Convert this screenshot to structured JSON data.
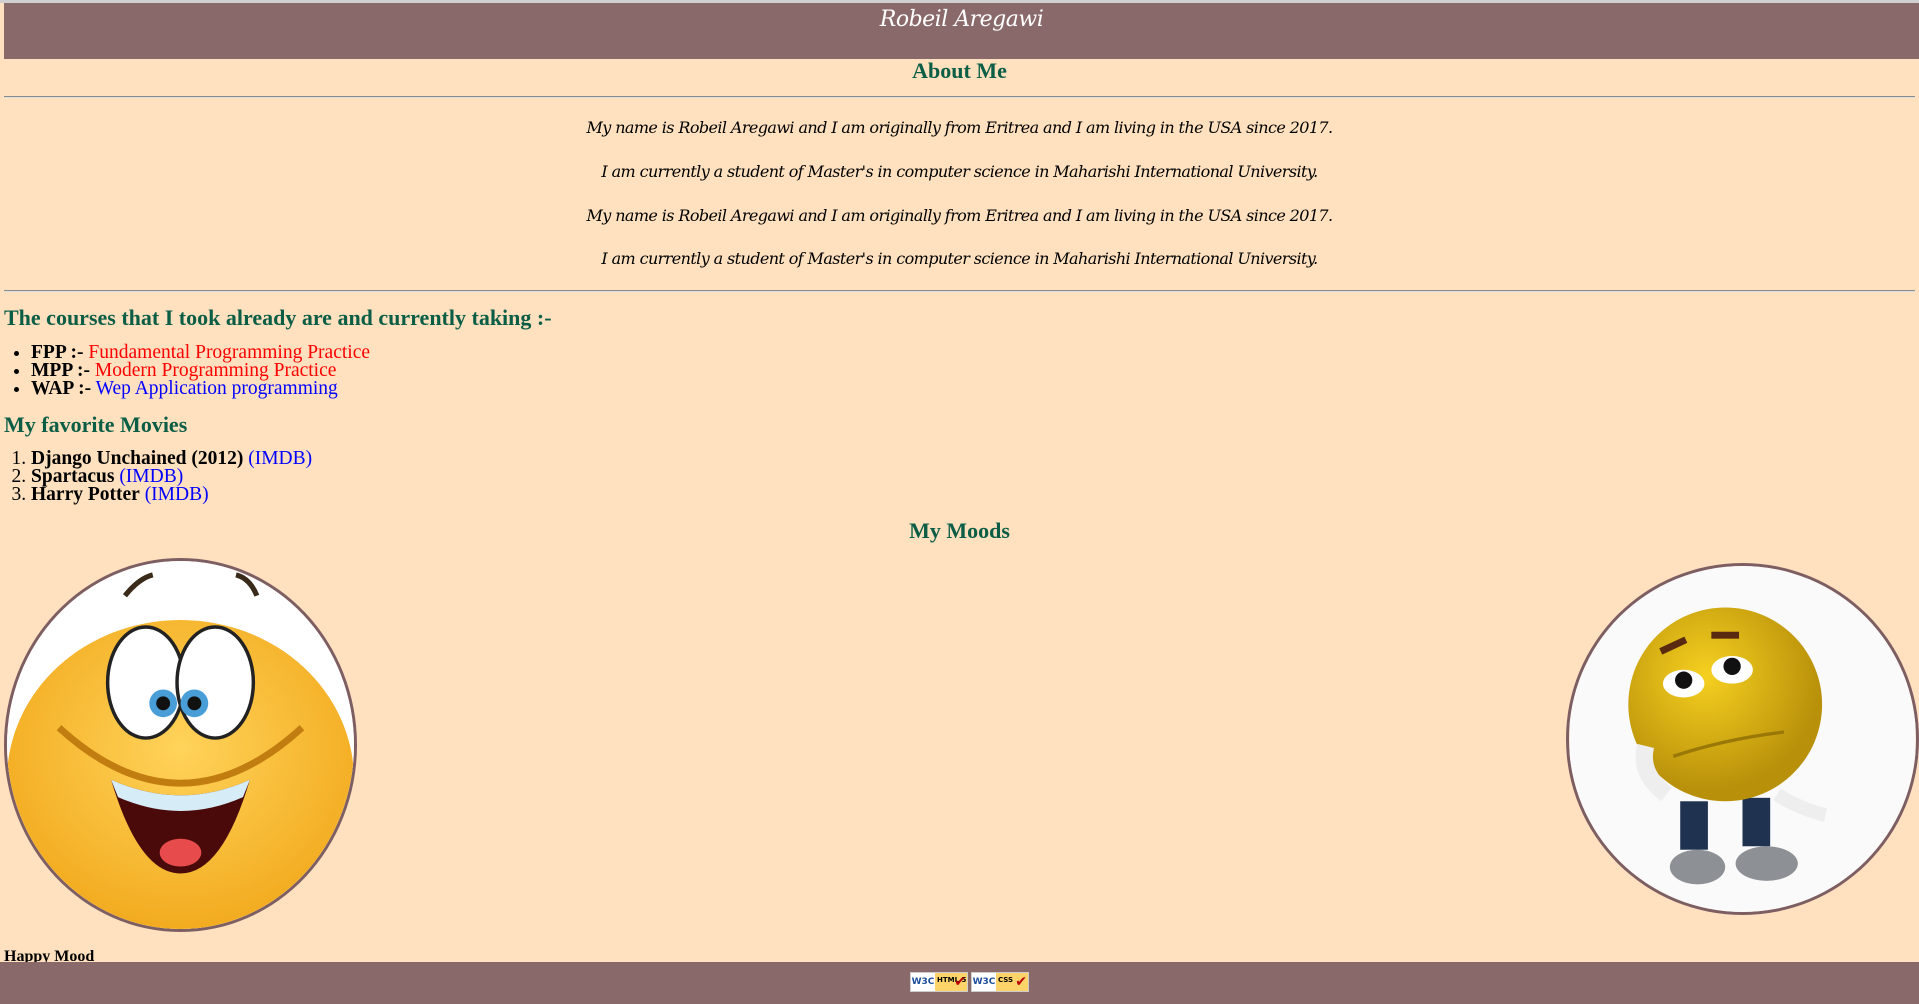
{
  "header": {
    "title": "Robeil Aregawi"
  },
  "about": {
    "heading": "About Me",
    "paragraphs": [
      "My name is Robeil Aregawi and I am originally from Eritrea and I am living in the USA since 2017.",
      "I am currently a student of Master's in computer science in Maharishi International University.",
      "My name is Robeil Aregawi and I am originally from Eritrea and I am living in the USA since 2017.",
      "I am currently a student of Master's in computer science in Maharishi International University."
    ]
  },
  "courses": {
    "heading": "The courses that I took already are and currently taking :-",
    "items": [
      {
        "code": "FPP :-",
        "name": "Fundamental Programming Practice",
        "color": "#ff0000"
      },
      {
        "code": "MPP :-",
        "name": "Modern Programming Practice",
        "color": "#ff0000"
      },
      {
        "code": "WAP :-",
        "name": "Wep Application programming",
        "color": "#0000ff"
      }
    ]
  },
  "movies": {
    "heading": "My favorite Movies",
    "items": [
      {
        "title": "Django Unchained (2012)",
        "link": "(IMDB)"
      },
      {
        "title": "Spartacus",
        "link": "(IMDB)"
      },
      {
        "title": "Harry Potter",
        "link": "(IMDB)"
      }
    ]
  },
  "moods": {
    "heading": "My Moods",
    "happy_caption": "Happy Mood"
  },
  "footer": {
    "badges": [
      {
        "logo": "W3C",
        "label": "HTML 5"
      },
      {
        "logo": "W3C",
        "label": "CSS"
      }
    ]
  },
  "colors": {
    "header_bg": "#89696a",
    "page_bg": "#ffe1bf",
    "heading": "#0b5e45"
  }
}
